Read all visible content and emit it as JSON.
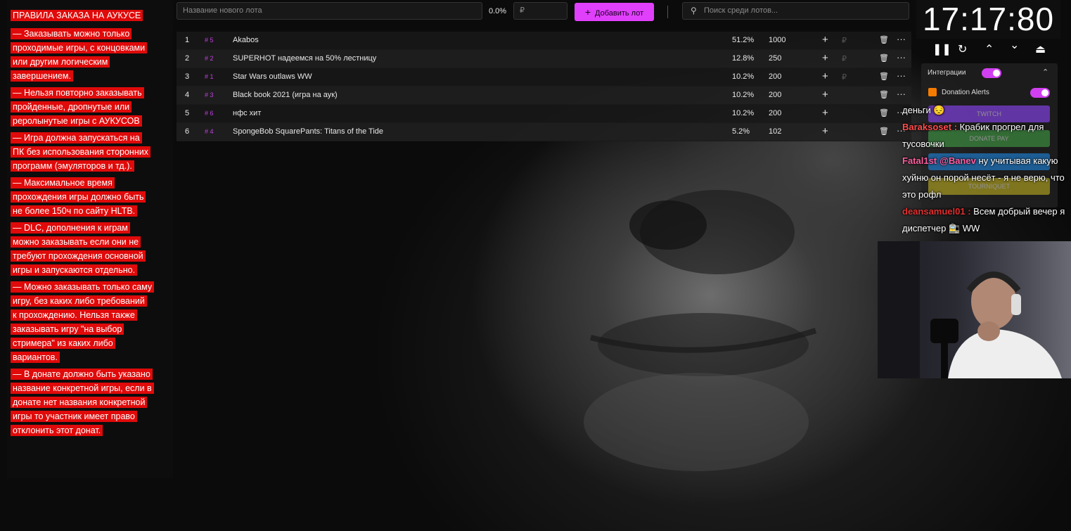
{
  "rules": {
    "paragraphs": [
      [
        "ПРАВИЛА ЗАКАЗА НА АУКУСЕ"
      ],
      [
        "— Заказывать можно только",
        "проходимые игры, с концовками",
        "или другим логическим",
        "завершением."
      ],
      [
        "— Нельзя повторно заказывать",
        "пройденные, дропнутые или",
        "реролынутые игры с АУКУСОВ"
      ],
      [
        "— Игра должна запускаться на",
        "ПК без использования сторонних",
        "программ (эмуляторов и тд.)."
      ],
      [
        "— Максимальное время",
        "прохождения игры должно быть",
        "не более 150ч по сайту HLTB."
      ],
      [
        "— DLC, дополнения к играм",
        "можно заказывать если они не",
        "требуют прохождения основной",
        "игры и запускаются отдельно."
      ],
      [
        "— Можно заказывать только саму",
        "игру, без каких либо требований",
        "к прохождению. Нельзя также",
        "заказывать игру \"на выбор",
        "стримера\" из каких либо",
        "вариантов."
      ],
      [
        "— В донате должно быть указано",
        "название конкретной игры, если в",
        "донате нет названия конкретной",
        "игры то участник имеет право",
        "отклонить этот донат."
      ]
    ]
  },
  "toolbar": {
    "lot_name_placeholder": "Название нового лота",
    "percent": "0.0%",
    "amount_placeholder": "₽",
    "add_label": "Добавить лот",
    "search_placeholder": "Поиск среди лотов..."
  },
  "lots": [
    {
      "num": "1",
      "id": "# 5",
      "name": "Akabos",
      "pct": "51.2%",
      "amount": "1000"
    },
    {
      "num": "2",
      "id": "# 2",
      "name": "SUPERHOT надеемся на 50% лестницу",
      "pct": "12.8%",
      "amount": "250"
    },
    {
      "num": "3",
      "id": "# 1",
      "name": " Star Wars outlaws WW",
      "pct": "10.2%",
      "amount": "200"
    },
    {
      "num": "4",
      "id": "# 3",
      "name": "Black book 2021 (игра на аук)",
      "pct": "10.2%",
      "amount": "200"
    },
    {
      "num": "5",
      "id": "# 6",
      "name": "нфс хит",
      "pct": "10.2%",
      "amount": "200"
    },
    {
      "num": "6",
      "id": "# 4",
      "name": "SpongeBob SquarePants: Titans of the Tide",
      "pct": "5.2%",
      "amount": "102"
    }
  ],
  "clock": {
    "time": "17:17:80"
  },
  "integrations": {
    "title": "Интеграции",
    "donation_alerts": "Donation Alerts",
    "twitch": "TWITCH",
    "donate_pay": "DONATE PAY",
    "tourniquet": "TOURNIQUET"
  },
  "chat": [
    {
      "nick": "",
      "nick_color": "#ffffff",
      "text": "деньги 😔"
    },
    {
      "nick": "Baraksoset :",
      "nick_color": "#ff4d4d",
      "text": " Крабик прогрел для тусовочки"
    },
    {
      "nick": "Fatal1st",
      "nick_color": "#ff5fa0",
      "mention": "@Banev",
      "text": " ну учитывая какую хуйню он порой несёт - я не верю, что это рофл"
    },
    {
      "nick": "deansamuel01 :",
      "nick_color": "#e03030",
      "text": " Всем добрый вечер я диспетчер 🚉 WW"
    }
  ],
  "colors": {
    "accent": "#e040fb",
    "rules_bg": "#e00a0a",
    "twitch": "#9146ff",
    "donate_pay": "#43a047",
    "tourniquet": "#c0b020",
    "blue_btn": "#1e88e5"
  }
}
